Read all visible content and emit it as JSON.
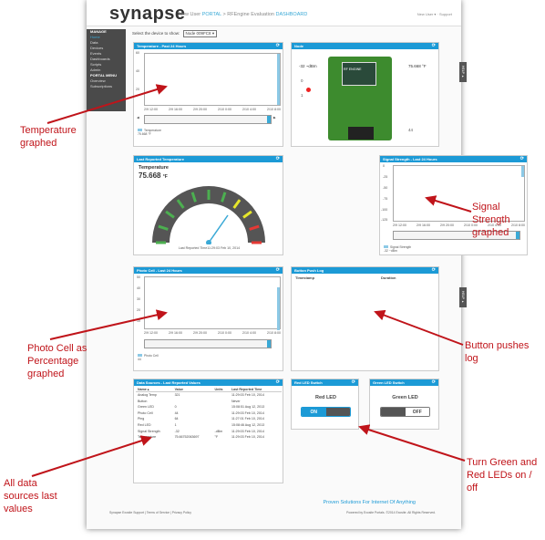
{
  "header": {
    "logo": "synapse",
    "crumb_a": "New User",
    "crumb_b": "PORTAL",
    "crumb_sep": ">",
    "crumb_c": "RFEngine Evaluation",
    "crumb_d": "DASHBOARD",
    "user": "New User ▾",
    "support": "Support"
  },
  "sidebar": {
    "items": [
      "MANAGE",
      "Home",
      "Data",
      "Devices",
      "Events",
      "Dashboards",
      "Scripts",
      "Admin",
      "PORTAL MENU",
      "Overview",
      "Subscriptions"
    ]
  },
  "select": {
    "label": "Select the device to show:",
    "value": "Node 009FC8 ▾"
  },
  "panels": {
    "temp": {
      "title": "Temperature - Past 24 Hours",
      "y_ticks": [
        "60",
        "40",
        "20"
      ],
      "x_ticks": [
        "2/9 12:00",
        "2/9 16:00",
        "2/9 20:00",
        "2/10 0:00",
        "2/10 4:00",
        "2/10 8:00"
      ],
      "legend": "Temperature",
      "legend_val": "75.668 °F"
    },
    "node": {
      "title": "Node",
      "dbm": "-32 ~dBm",
      "temp": "75.668 °F",
      "l0": "0",
      "l1": "1",
      "v44": "44",
      "board": "RF ENGINE"
    },
    "last": {
      "title": "Last Reported Temperature",
      "label": "Temperature",
      "value": "75.668",
      "unit": "°F",
      "gauge": [
        "0",
        "11",
        "22",
        "33",
        "44",
        "55",
        "66",
        "77",
        "88",
        "99",
        "110"
      ],
      "footer": "Last Reported Time11:29:03 Feb 10, 2014"
    },
    "signal": {
      "title": "Signal Strength - Last 24 Hours",
      "y_ticks": [
        "0",
        "-25",
        "-50",
        "-75",
        "-100",
        "-125"
      ],
      "x_ticks": [
        "2/9 12:00",
        "2/9 16:00",
        "2/9 20:00",
        "2/10 0:00",
        "2/10 4:00",
        "2/10 8:00"
      ],
      "legend": "Signal Strength",
      "legend_val": "-32 ~dBm"
    },
    "photo": {
      "title": "Photo Cell - Last 24 Hours",
      "y_ticks": [
        "50",
        "40",
        "30",
        "20",
        "10"
      ],
      "x_ticks": [
        "2/9 12:00",
        "2/9 16:00",
        "2/9 20:00",
        "2/10 0:00",
        "2/10 4:00",
        "2/10 8:00"
      ],
      "legend": "Photo Cell",
      "legend_val": "44"
    },
    "button": {
      "title": "Button Push Log",
      "col1": "Timestamp",
      "col2": "Duration"
    },
    "sources": {
      "title": "Data Sources - Last Reported Values",
      "cols": [
        "Name ▴",
        "Value",
        "Units",
        "Last Reported Time"
      ],
      "rows": [
        [
          "Analog Temp",
          "321",
          "",
          "11:29:03 Feb 10, 2014"
        ],
        [
          "Button",
          "",
          "",
          "Never"
        ],
        [
          "Green LED",
          "0",
          "",
          "15:08:51 Aug 12, 2013"
        ],
        [
          "Photo Cell",
          "44",
          "",
          "11:29:03 Feb 10, 2014"
        ],
        [
          "Ping",
          "64",
          "",
          "11:27:01 Feb 10, 2014"
        ],
        [
          "Red LED",
          "1",
          "",
          "15:08:46 Aug 12, 2013"
        ],
        [
          "Signal Strength",
          "-32",
          "-dBm",
          "11:29:03 Feb 10, 2014"
        ],
        [
          "Temperature",
          "75.66752063697",
          "°F",
          "11:29:03 Feb 10, 2014"
        ]
      ]
    },
    "red": {
      "title": "Red LED Switch",
      "label": "Red LED",
      "on": "ON"
    },
    "green": {
      "title": "Green LED Switch",
      "label": "Green LED",
      "off": "OFF"
    }
  },
  "help": "HELP ▸",
  "footer": {
    "left": "Synapse Exosite Support | Terms of Service | Privacy Policy",
    "tag": "Proven Solutions For Internet Of Anything",
    "right": "Powered by Exosite Portals. ©2014 Exosite. All Rights Reserved."
  },
  "annotations": {
    "temp": "Temperature graphed",
    "signal": "Signal Strength graphed",
    "photo": "Photo Cell as Percentage graphed",
    "button": "Button pushes log",
    "all": "All data sources last values",
    "leds": "Turn Green and Red LEDs on / off"
  },
  "colors": {
    "accent": "#1c9ad6",
    "annotation": "#c0141a"
  }
}
